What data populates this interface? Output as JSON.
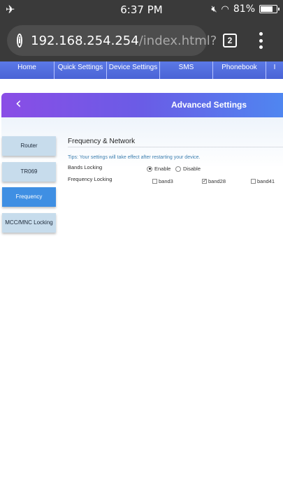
{
  "status_bar": {
    "time": "6:37 PM",
    "battery": "81%",
    "battery_level": 0.81,
    "icons": [
      "airplane-icon",
      "mute-icon",
      "wifi-icon",
      "battery-icon"
    ]
  },
  "browser": {
    "url_host": "192.168.254.254",
    "url_path": "/index.html?",
    "tab_count": "2"
  },
  "top_nav": {
    "items": [
      "Home",
      "Quick Settings",
      "Device Settings",
      "SMS",
      "Phonebook",
      "I"
    ]
  },
  "header": {
    "title": "Advanced Settings"
  },
  "side_menu": {
    "items": [
      "Router",
      "TR069",
      "Frequency",
      "MCC/MNC Locking"
    ],
    "active": "Frequency"
  },
  "content": {
    "section_title": "Frequency & Network",
    "tips": "Tips: Your settings will take effect after restarting your device.",
    "bands_locking": {
      "label": "Bands Locking",
      "options": [
        "Enable",
        "Disable"
      ],
      "selected": "Enable"
    },
    "frequency_locking": {
      "label": "Frequency Locking",
      "bands": [
        {
          "name": "band3",
          "checked": false
        },
        {
          "name": "band28",
          "checked": true
        },
        {
          "name": "band41",
          "checked": false
        }
      ]
    }
  },
  "colors": {
    "nav_blue": "#4a63d6",
    "header_start": "#8a4de6",
    "header_end": "#4f86f0",
    "side_inactive": "#c7dcec",
    "side_active": "#3f8fe3",
    "tips_text": "#3d7fb0"
  }
}
